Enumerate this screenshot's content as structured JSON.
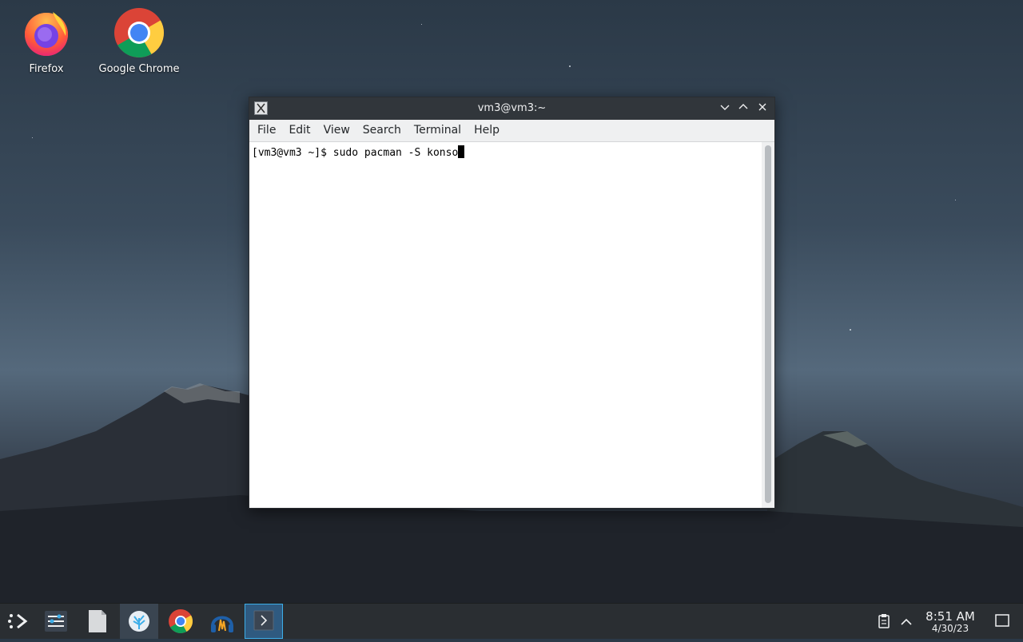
{
  "desktop": {
    "icons": [
      {
        "label": "Firefox"
      },
      {
        "label": "Google Chrome"
      }
    ]
  },
  "window": {
    "title": "vm3@vm3:~",
    "menu": [
      "File",
      "Edit",
      "View",
      "Search",
      "Terminal",
      "Help"
    ],
    "terminal": {
      "prompt": "[vm3@vm3 ~]$ ",
      "command": "sudo pacman -S konso"
    }
  },
  "taskbar": {
    "clock_time": "8:51 AM",
    "clock_date": "4/30/23"
  },
  "colors": {
    "accent": "#3daee9",
    "titlebar": "#31363b",
    "taskbar": "#2a2e32"
  }
}
